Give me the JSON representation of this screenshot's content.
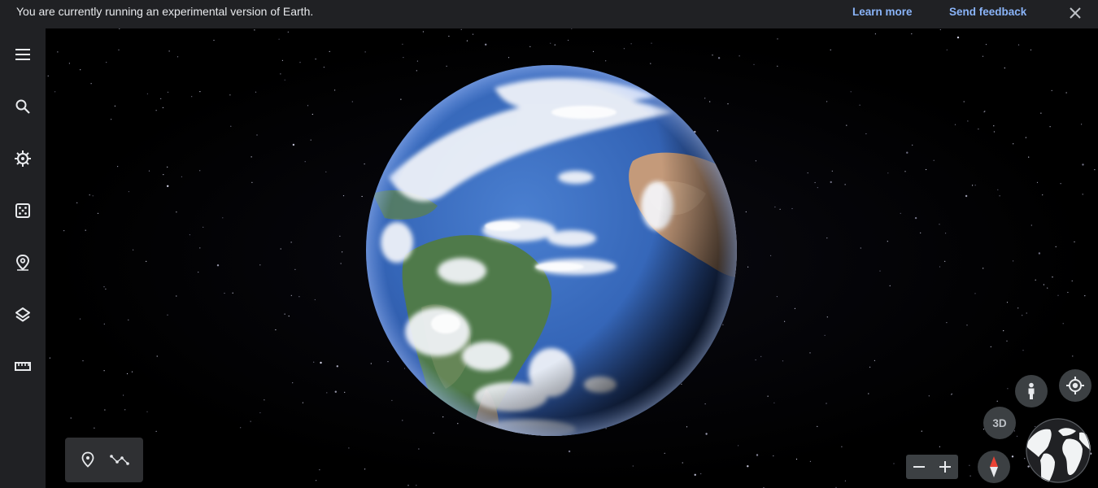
{
  "banner": {
    "message": "You are currently running an experimental version of Earth.",
    "learn_more": "Learn more",
    "send_feedback": "Send feedback",
    "close_icon": "close-icon"
  },
  "sidebar": {
    "items": [
      {
        "name": "menu-icon"
      },
      {
        "name": "search-icon"
      },
      {
        "name": "voyager-icon"
      },
      {
        "name": "feeling-lucky-icon"
      },
      {
        "name": "projects-icon"
      },
      {
        "name": "map-style-icon"
      },
      {
        "name": "measure-icon"
      }
    ]
  },
  "tools": {
    "items": [
      {
        "name": "add-placemark-icon"
      },
      {
        "name": "draw-line-icon"
      }
    ]
  },
  "controls": {
    "view_3d_label": "3D",
    "pegman_icon": "pegman-icon",
    "my_location_icon": "my-location-icon",
    "compass_icon": "compass-icon",
    "zoom_out_icon": "minus-icon",
    "zoom_in_icon": "plus-icon"
  },
  "colors": {
    "bar_bg": "#202124",
    "link": "#8ab4f8",
    "control_bg": "#3c4043",
    "ocean": "#3c6fc0",
    "compass_red": "#ea4335"
  }
}
